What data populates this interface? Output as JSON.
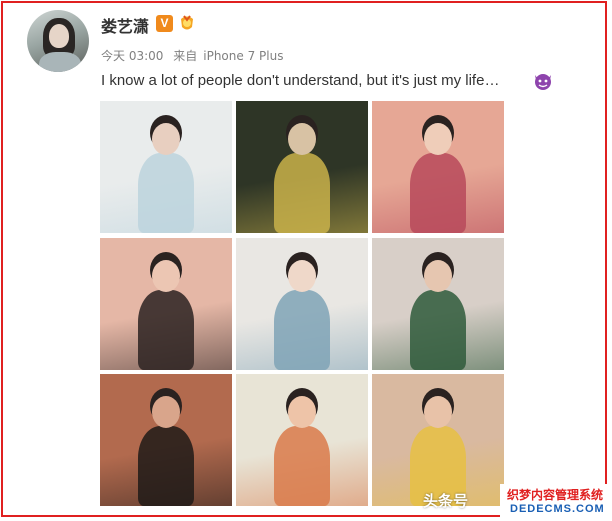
{
  "post": {
    "username": "娄艺潇",
    "verified_badge": "V",
    "time": "今天 03:00",
    "source_prefix": "来自",
    "device": "iPhone 7 Plus",
    "text": "I know a lot of people don't understand, but it's just my life…",
    "emoji": "devil-emoji-icon"
  },
  "photos": [
    {
      "name": "photo-1",
      "bg": "#e9ecec",
      "accent": "#bcd3dd",
      "skin": "#e8cfc0"
    },
    {
      "name": "photo-2",
      "bg": "#2e3526",
      "accent": "#c9b24a",
      "skin": "#d8c2a4"
    },
    {
      "name": "photo-3",
      "bg": "#e6a795",
      "accent": "#b7495a",
      "skin": "#efcdb9"
    },
    {
      "name": "photo-4",
      "bg": "#e5b7a6",
      "accent": "#2c2221",
      "skin": "#ecc6b3"
    },
    {
      "name": "photo-5",
      "bg": "#e9e7e3",
      "accent": "#7fa3b6",
      "skin": "#efd8c9"
    },
    {
      "name": "photo-6",
      "bg": "#d8cfc8",
      "accent": "#2f5a3b",
      "skin": "#e6c6b0"
    },
    {
      "name": "photo-7",
      "bg": "#b26a4e",
      "accent": "#1f1a18",
      "skin": "#d9a58b"
    },
    {
      "name": "photo-8",
      "bg": "#e8e4d6",
      "accent": "#d97a4a",
      "skin": "#eec4a8"
    },
    {
      "name": "photo-9",
      "bg": "#d9b9a0",
      "accent": "#e6c043",
      "skin": "#e8c2a8"
    }
  ],
  "watermark": {
    "site": "头条号",
    "logo_cn": "织梦内容管理系统",
    "logo_en": "DEDECMS.COM"
  },
  "colors": {
    "frame": "#e02020",
    "username": "#333333",
    "meta": "#808080",
    "badge": "#f08a1c",
    "logo_blue": "#1a5fb4"
  }
}
